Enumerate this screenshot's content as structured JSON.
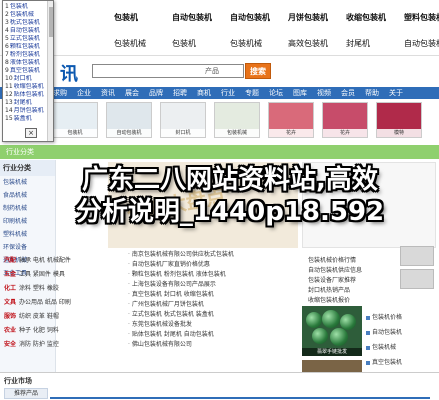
{
  "topnav": {
    "row1": [
      "",
      "包装机",
      "自动包装机",
      "自动包装机",
      "月饼包装机",
      "收缩包装机",
      "塑料包装机"
    ],
    "row2": [
      "",
      "包装机械",
      "包装机",
      "包装机械",
      "高效包装机",
      "封尾机",
      "自动包装机"
    ]
  },
  "popup": {
    "items": [
      {
        "n": "1",
        "label": "包装机"
      },
      {
        "n": "2",
        "label": "包装机械"
      },
      {
        "n": "3",
        "label": "枕式包装机"
      },
      {
        "n": "4",
        "label": "自动包装机"
      },
      {
        "n": "5",
        "label": "立式包装机"
      },
      {
        "n": "6",
        "label": "颗粒包装机"
      },
      {
        "n": "7",
        "label": "粉剂包装机"
      },
      {
        "n": "8",
        "label": "液体包装机"
      },
      {
        "n": "9",
        "label": "真空包装机"
      },
      {
        "n": "10",
        "label": "封口机"
      },
      {
        "n": "11",
        "label": "收缩包装机"
      },
      {
        "n": "12",
        "label": "贴体包装机"
      },
      {
        "n": "13",
        "label": "封尾机"
      },
      {
        "n": "14",
        "label": "月饼包装机"
      },
      {
        "n": "15",
        "label": "装盒机"
      }
    ],
    "close_label": "×"
  },
  "header": {
    "logo": "讯",
    "search_placeholder": "",
    "search_select": "产品",
    "search_button": "搜索"
  },
  "tabs": [
    "首页",
    "供应",
    "求购",
    "企业",
    "资讯",
    "展会",
    "品牌",
    "招聘",
    "商机",
    "行业",
    "专题",
    "论坛",
    "图库",
    "视频",
    "会员",
    "帮助",
    "关于"
  ],
  "photos": [
    {
      "caption": "包装机"
    },
    {
      "caption": "自动包装机"
    },
    {
      "caption": "封口机"
    },
    {
      "caption": "包装机械"
    },
    {
      "caption": "花卉"
    },
    {
      "caption": "花卉"
    },
    {
      "caption": "模特"
    }
  ],
  "greenstrip": {
    "label": "行业分类"
  },
  "leftcol": {
    "header": "行业分类",
    "rows": [
      {
        "text": "包装机械",
        "red": false
      },
      {
        "text": "食品机械",
        "red": false
      },
      {
        "text": "制药机械",
        "red": false
      },
      {
        "text": "印刷机械",
        "red": false
      },
      {
        "text": "塑料机械",
        "red": false
      },
      {
        "text": "环保设备",
        "red": false
      },
      {
        "text": "通用机械",
        "red": false
      },
      {
        "text": "五金工具",
        "red": false
      }
    ]
  },
  "midcat": [
    {
      "k": "汽配",
      "text": "轴承 电机 机械配件"
    },
    {
      "k": "五金",
      "text": "工具 紧固件 模具"
    },
    {
      "k": "化工",
      "text": "涂料 塑料 橡胶"
    },
    {
      "k": "文具",
      "text": "办公用品 纸品 印刷"
    },
    {
      "k": "服饰",
      "text": "纺织 皮革 鞋帽"
    },
    {
      "k": "农业",
      "text": "种子 化肥 饲料"
    },
    {
      "k": "安全",
      "text": "消防 防护 监控"
    }
  ],
  "center_lines": [
    "南京包装机械有限公司供应枕式包装机",
    "自动包装机厂家直销价格优惠",
    "颗粒包装机 粉剂包装机 液体包装机",
    "上海包装设备有限公司产品展示",
    "真空包装机 封口机 收缩包装机",
    "广州包装机械厂月饼包装机",
    "立式包装机 枕式包装机 装盒机",
    "东莞包装机械设备批发",
    "贴体包装机 封尾机 自动包装机",
    "佛山包装机械有限公司"
  ],
  "rightcol": {
    "list": [
      "包装机械价格行情",
      "自动包装机供应信息",
      "包装设备厂家推荐",
      "封口机热销产品",
      "收缩包装机报价"
    ],
    "green_caption": "翡翠手链批发",
    "links": [
      "包装机价格",
      "自动包装机",
      "包装机械",
      "真空包装机",
      "封口机"
    ]
  },
  "overlay": {
    "line1": "广东二八网站资料站,高效",
    "line2": "分析说明_1440p18.592"
  },
  "bottom": {
    "header": "行业市场",
    "tab": "推荐产品"
  }
}
